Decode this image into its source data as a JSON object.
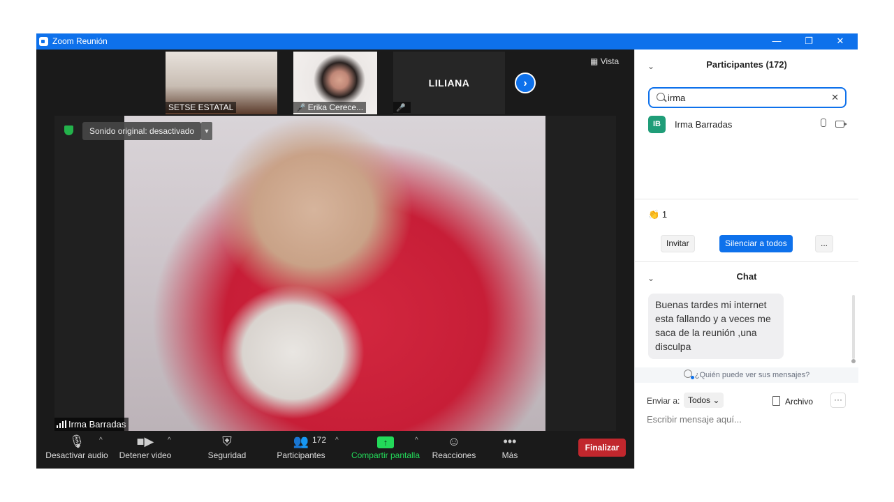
{
  "window": {
    "title": "Zoom Reunión",
    "controls": {
      "minimize": "—",
      "restore": "❐",
      "close": "✕"
    }
  },
  "thumbnails": [
    {
      "label": "SETSE ESTATAL",
      "muted": false
    },
    {
      "label": "Erika Cerece...",
      "muted": true
    },
    {
      "label": "",
      "center_name": "LILIANA",
      "muted": true
    }
  ],
  "view_label": "Vista",
  "main_video": {
    "sound_label": "Sonido original: desactivado",
    "speaker_name": "Irma Barradas"
  },
  "toolbar": {
    "audio": "Desactivar audio",
    "video": "Detener video",
    "security": "Seguridad",
    "participants": "Participantes",
    "participants_count": "172",
    "share": "Compartir pantalla",
    "reactions": "Reacciones",
    "more": "Más",
    "end": "Finalizar"
  },
  "participants_panel": {
    "title": "Participantes (172)",
    "search_value": "irma",
    "results": [
      {
        "initials": "IB",
        "name": "Irma Barradas"
      }
    ],
    "clap_count": "1",
    "invite": "Invitar",
    "mute_all": "Silenciar a todos",
    "more": "..."
  },
  "chat": {
    "title": "Chat",
    "message": "Buenas tardes mi internet esta fallando y a veces me saca de la reunión ,una disculpa",
    "who_can_see": "¿Quién puede ver sus mensajes?",
    "send_to_label": "Enviar a:",
    "send_to_value": "Todos",
    "file": "Archivo",
    "more": "···",
    "input_placeholder": "Escribir mensaje aquí..."
  },
  "colors": {
    "accent": "#0e71eb",
    "end": "#c1272d",
    "share": "#23d959",
    "avatar": "#1f9d78"
  }
}
